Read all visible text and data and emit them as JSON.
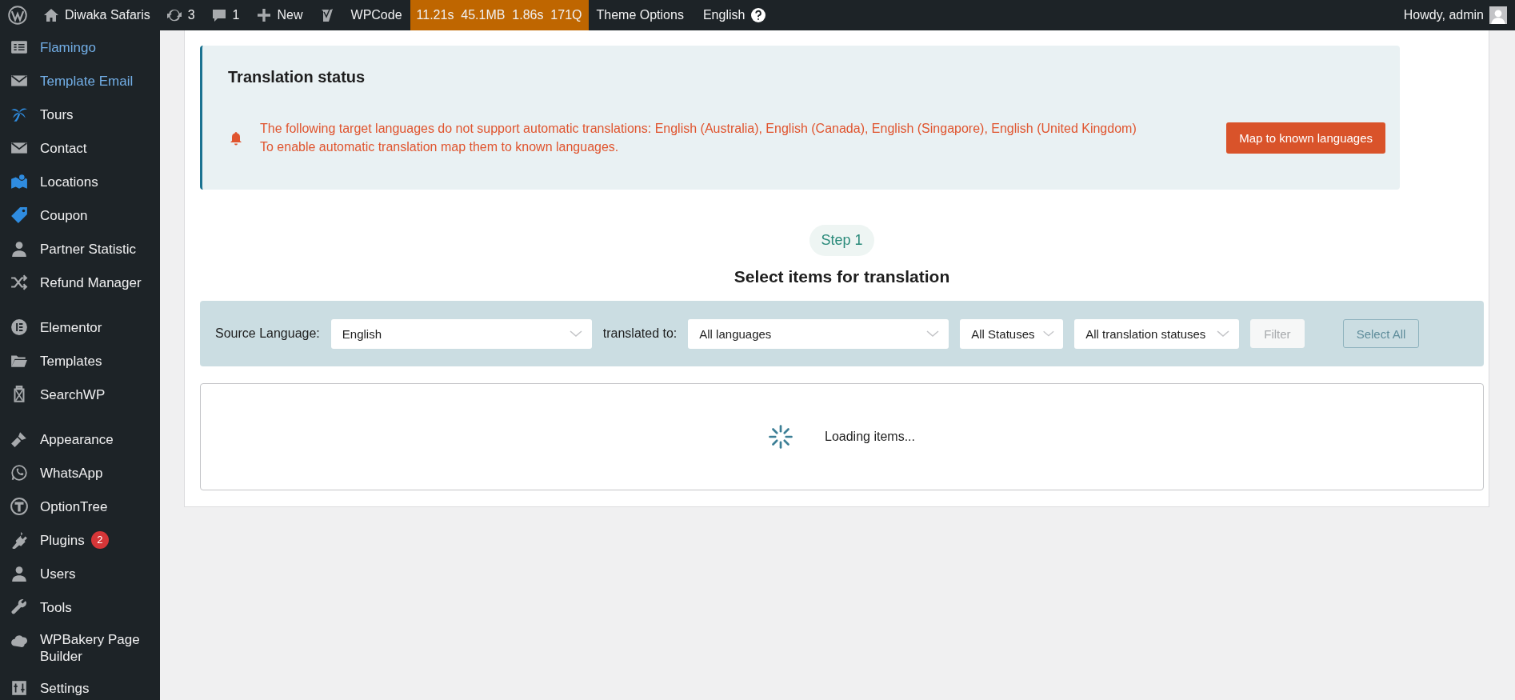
{
  "admin_bar": {
    "site_name": "Diwaka Safaris",
    "updates": "3",
    "comments": "1",
    "new": "New",
    "wpcode": "WPCode",
    "query_monitor": [
      "11.21s",
      "45.1MB",
      "1.86s",
      "171Q"
    ],
    "theme_options": "Theme Options",
    "language": "English",
    "greeting": "Howdy, admin"
  },
  "sidebar": {
    "sections": [
      {
        "items": [
          {
            "label": "Flamingo",
            "highlighted": true
          },
          {
            "label": "Template Email",
            "highlighted": true
          },
          {
            "label": "Tours",
            "highlighted": false
          },
          {
            "label": "Contact",
            "highlighted": false
          },
          {
            "label": "Locations",
            "highlighted": false
          },
          {
            "label": "Coupon",
            "highlighted": false
          },
          {
            "label": "Partner Statistic",
            "highlighted": false
          },
          {
            "label": "Refund Manager",
            "highlighted": false
          }
        ]
      },
      {
        "items": [
          {
            "label": "Elementor",
            "highlighted": false
          },
          {
            "label": "Templates",
            "highlighted": false
          },
          {
            "label": "SearchWP",
            "highlighted": false
          }
        ]
      },
      {
        "items": [
          {
            "label": "Appearance",
            "highlighted": false
          },
          {
            "label": "WhatsApp",
            "highlighted": false
          },
          {
            "label": "OptionTree",
            "highlighted": false
          },
          {
            "label": "Plugins",
            "highlighted": false,
            "badge": "2"
          },
          {
            "label": "Users",
            "highlighted": false
          },
          {
            "label": "Tools",
            "highlighted": false
          },
          {
            "label": "WPBakery Page Builder",
            "highlighted": false
          },
          {
            "label": "Settings",
            "highlighted": false
          }
        ]
      }
    ]
  },
  "translation_status": {
    "title": "Translation status",
    "notice_lines": [
      "The following target languages do not support automatic translations: English (Australia), English (Canada), English (Singapore), English (United Kingdom)",
      "To enable automatic translation map them to known languages."
    ],
    "button": "Map to known languages"
  },
  "step": {
    "badge": "Step 1",
    "title": "Select items for translation"
  },
  "filters": {
    "source_label": "Source Language:",
    "source_value": "English",
    "target_label": "translated to:",
    "target_value": "All languages",
    "status_value": "All Statuses",
    "translation_status_value": "All translation statuses",
    "buttons": [
      {
        "label": "Filter",
        "kind": "filled",
        "disabled": true
      },
      {
        "label": "Select All",
        "kind": "outline",
        "disabled": true
      }
    ]
  },
  "loading": {
    "text": "Loading items..."
  }
}
